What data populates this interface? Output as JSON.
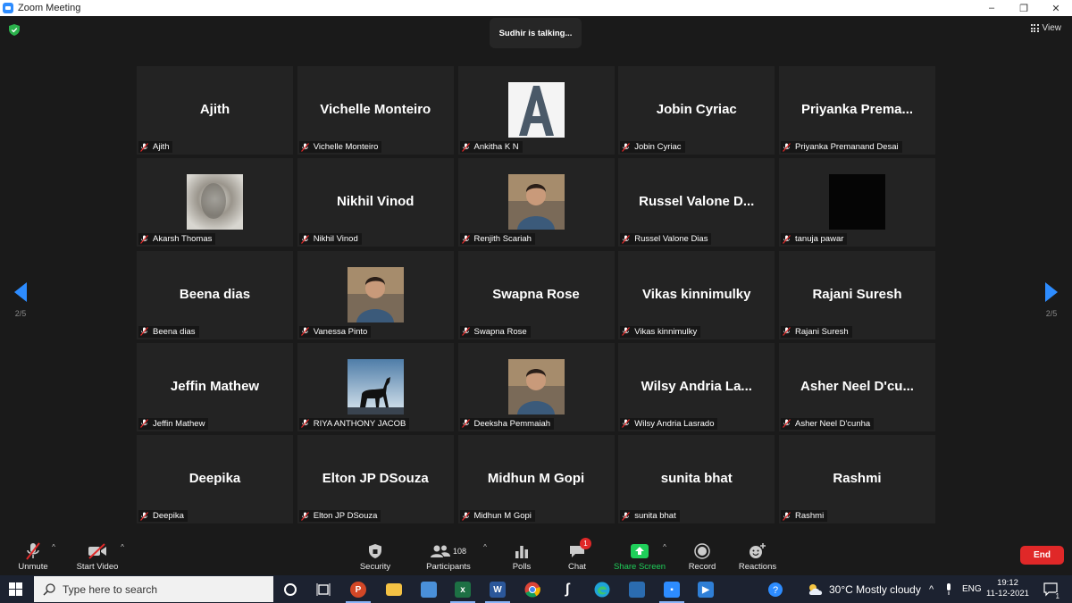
{
  "window": {
    "title": "Zoom Meeting",
    "controls": [
      "–",
      "❐",
      "✕"
    ]
  },
  "meeting": {
    "talking_indicator": "Sudhir is talking...",
    "view_label": "View",
    "page_indicator": "2/5",
    "accent_color": "#2d8cff"
  },
  "participants": [
    {
      "big_name": "Ajith",
      "label": "Ajith",
      "avatar": "none"
    },
    {
      "big_name": "Vichelle Monteiro",
      "label": "Vichelle Monteiro",
      "avatar": "none"
    },
    {
      "big_name": "",
      "label": "Ankitha K N",
      "avatar": "letter-a-image"
    },
    {
      "big_name": "Jobin Cyriac",
      "label": "Jobin Cyriac",
      "avatar": "none"
    },
    {
      "big_name": "Priyanka  Prema...",
      "label": "Priyanka Premanand Desai",
      "avatar": "none"
    },
    {
      "big_name": "",
      "label": "Akarsh Thomas",
      "avatar": "blurred-photo"
    },
    {
      "big_name": "Nikhil Vinod",
      "label": "Nikhil Vinod",
      "avatar": "none"
    },
    {
      "big_name": "",
      "label": "Renjith Scariah",
      "avatar": "person-photo"
    },
    {
      "big_name": "Russel  Valone  D...",
      "label": "Russel Valone Dias",
      "avatar": "none"
    },
    {
      "big_name": "",
      "label": "tanuja pawar",
      "avatar": "black-image"
    },
    {
      "big_name": "Beena dias",
      "label": "Beena dias",
      "avatar": "none"
    },
    {
      "big_name": "",
      "label": "Vanessa Pinto",
      "avatar": "person-photo"
    },
    {
      "big_name": "Swapna Rose",
      "label": "Swapna Rose",
      "avatar": "none"
    },
    {
      "big_name": "Vikas kinnimulky",
      "label": "Vikas kinnimulky",
      "avatar": "none"
    },
    {
      "big_name": "Rajani Suresh",
      "label": "Rajani Suresh",
      "avatar": "none"
    },
    {
      "big_name": "Jeffin Mathew",
      "label": "Jeffin Mathew",
      "avatar": "none"
    },
    {
      "big_name": "",
      "label": "RIYA ANTHONY JACOB",
      "avatar": "horse-silhouette-photo"
    },
    {
      "big_name": "",
      "label": "Deeksha Pemmaiah",
      "avatar": "person-photo"
    },
    {
      "big_name": "Wilsy  Andria  La...",
      "label": "Wilsy Andria Lasrado",
      "avatar": "none"
    },
    {
      "big_name": "Asher  Neel  D'cu...",
      "label": "Asher Neel D'cunha",
      "avatar": "none"
    },
    {
      "big_name": "Deepika",
      "label": "Deepika",
      "avatar": "none"
    },
    {
      "big_name": "Elton JP DSouza",
      "label": "Elton JP DSouza",
      "avatar": "none"
    },
    {
      "big_name": "Midhun M Gopi",
      "label": "Midhun M Gopi",
      "avatar": "none"
    },
    {
      "big_name": "sunita bhat",
      "label": "sunita bhat",
      "avatar": "none"
    },
    {
      "big_name": "Rashmi",
      "label": "Rashmi",
      "avatar": "none"
    }
  ],
  "controls": {
    "unmute": "Unmute",
    "start_video": "Start Video",
    "security": "Security",
    "participants": "Participants",
    "participant_count": "108",
    "polls": "Polls",
    "chat": "Chat",
    "chat_badge": "1",
    "share_screen": "Share Screen",
    "record": "Record",
    "reactions": "Reactions",
    "end": "End",
    "end_color": "#e02828",
    "share_color": "#1fcf5a"
  },
  "taskbar": {
    "search_placeholder": "Type here to search",
    "weather": "30°C  Mostly cloudy",
    "language": "ENG",
    "time": "19:12",
    "date": "11-12-2021",
    "notification_count": "1",
    "apps": [
      "task-view-icon",
      "powerpoint-icon",
      "file-explorer-icon",
      "remote-desktop-icon",
      "excel-icon",
      "word-icon",
      "chrome-icon",
      "app-s-icon",
      "edge-icon",
      "photos-icon",
      "zoom-icon",
      "media-icon"
    ]
  }
}
